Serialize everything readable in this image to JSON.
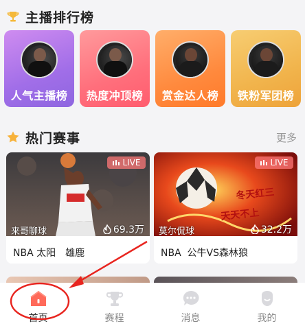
{
  "ranking": {
    "title": "主播排行榜",
    "cards": [
      {
        "label": "人气主播榜"
      },
      {
        "label": "热度冲顶榜"
      },
      {
        "label": "赏金达人榜"
      },
      {
        "label": "铁粉军团榜"
      }
    ]
  },
  "hot": {
    "title": "热门赛事",
    "more": "更多",
    "matches": [
      {
        "live": "LIVE",
        "streamer": "来哥聊球",
        "heat": "69.3万",
        "name": "NBA 太阳　雄鹿"
      },
      {
        "live": "LIVE",
        "streamer": "莫尔侃球",
        "heat": "32.2万",
        "name": "NBA  公牛VS森林狼"
      }
    ]
  },
  "tabs": [
    {
      "label": "首页",
      "icon": "home-icon"
    },
    {
      "label": "赛程",
      "icon": "trophy-icon"
    },
    {
      "label": "消息",
      "icon": "chat-icon"
    },
    {
      "label": "我的",
      "icon": "profile-icon"
    }
  ],
  "colors": {
    "accent": "#ff6a5a",
    "annotation": "#e8251f"
  }
}
